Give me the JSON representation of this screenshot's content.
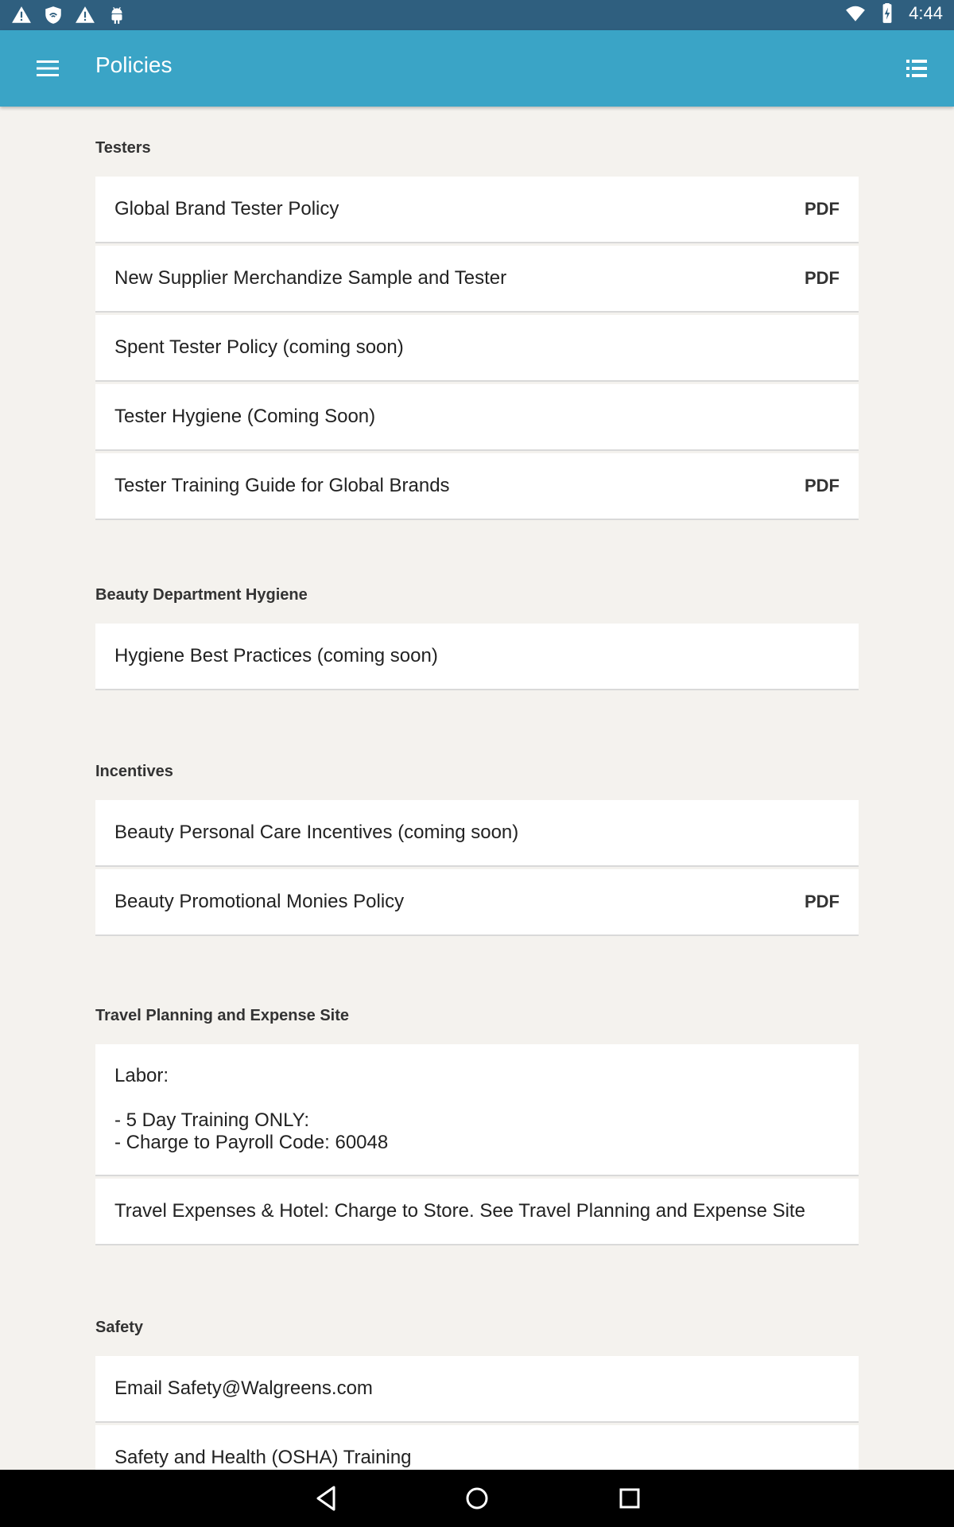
{
  "status_bar": {
    "time": "4:44",
    "icons_left": [
      "warning-icon",
      "shield-icon",
      "warning-icon",
      "android-icon"
    ],
    "icons_right": [
      "wifi-icon",
      "battery-icon"
    ]
  },
  "app_bar": {
    "title": "Policies",
    "menu_icon": "hamburger-menu-icon",
    "action_icon": "list-view-icon",
    "background": "#3aa4c6"
  },
  "sections": [
    {
      "header": "Testers",
      "items": [
        {
          "label": "Global Brand Tester Policy",
          "badge": "PDF"
        },
        {
          "label": "New Supplier Merchandize Sample and Tester",
          "badge": "PDF"
        },
        {
          "label": "Spent Tester Policy (coming soon)",
          "badge": ""
        },
        {
          "label": "Tester Hygiene (Coming Soon)",
          "badge": ""
        },
        {
          "label": "Tester Training Guide for Global Brands",
          "badge": "PDF"
        }
      ]
    },
    {
      "header": "Beauty Department Hygiene",
      "items": [
        {
          "label": "Hygiene Best Practices (coming soon)",
          "badge": ""
        }
      ]
    },
    {
      "header": "Incentives",
      "items": [
        {
          "label": "Beauty Personal Care Incentives (coming soon)",
          "badge": ""
        },
        {
          "label": "Beauty Promotional Monies Policy",
          "badge": "PDF"
        }
      ]
    },
    {
      "header": "Travel Planning and Expense Site",
      "items": [
        {
          "label": "Labor:\n\n- 5 Day Training ONLY:\n- Charge to Payroll Code: 60048",
          "badge": ""
        },
        {
          "label": "Travel Expenses & Hotel: Charge to Store. See Travel Planning and Expense Site",
          "badge": ""
        }
      ]
    },
    {
      "header": "Safety",
      "items": [
        {
          "label": "Email Safety@Walgreens.com",
          "badge": ""
        },
        {
          "label": "Safety and Health (OSHA) Training",
          "badge": ""
        }
      ]
    }
  ],
  "nav_bar": {
    "buttons": [
      "back-icon",
      "home-icon",
      "recents-icon"
    ]
  }
}
